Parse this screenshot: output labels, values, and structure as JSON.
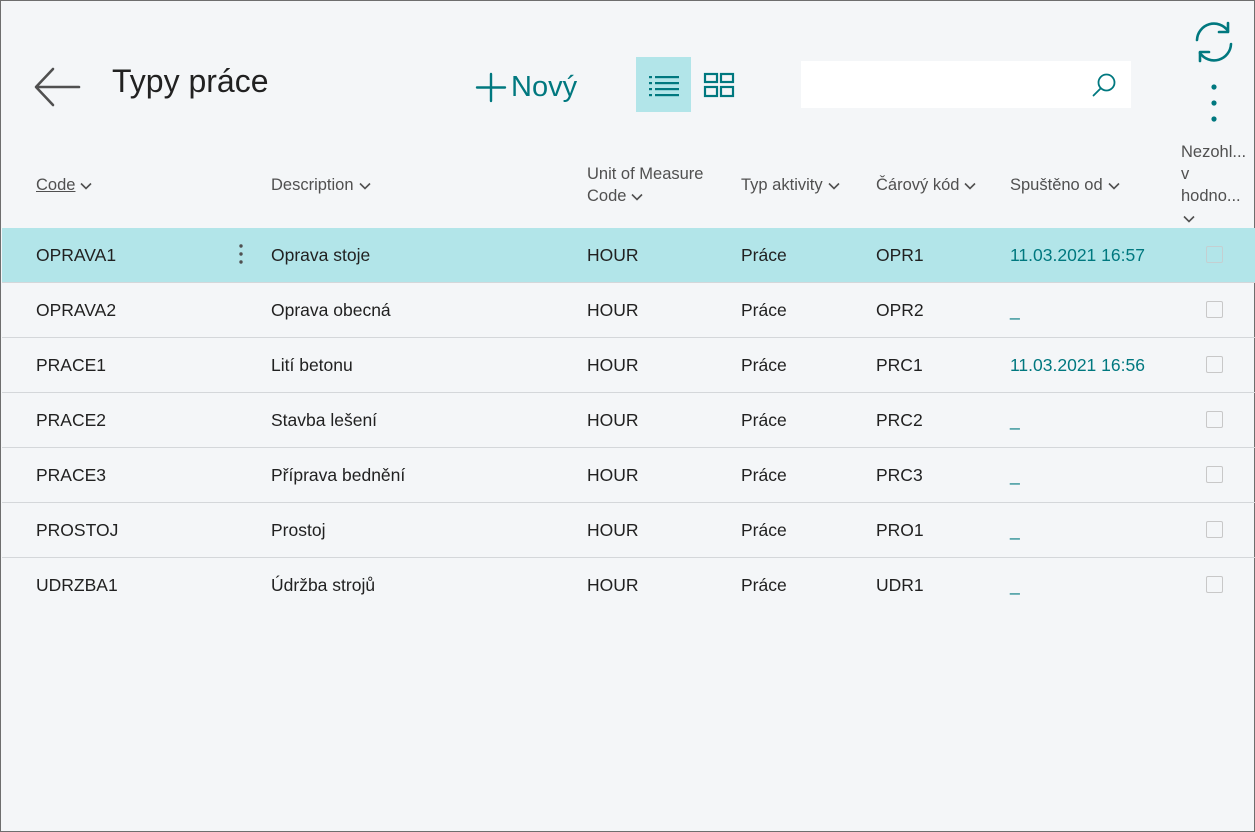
{
  "header": {
    "title": "Typy práce",
    "new_label": "Nový",
    "search": {
      "value": "",
      "placeholder": ""
    }
  },
  "columns": [
    {
      "key": "code",
      "label": "Code"
    },
    {
      "key": "description",
      "label": "Description"
    },
    {
      "key": "uom",
      "label": "Unit of Measure Code",
      "label_line1": "Unit of Measure",
      "label_line2": "Code"
    },
    {
      "key": "activity",
      "label": "Typ aktivity"
    },
    {
      "key": "barcode",
      "label": "Čárový kód"
    },
    {
      "key": "started",
      "label": "Spuštěno od"
    },
    {
      "key": "hidden",
      "label": "Nezohl... v hodno...",
      "label_line1": "Nezohl...",
      "label_line2": "v",
      "label_line3": "hodno..."
    }
  ],
  "rows": [
    {
      "code": "OPRAVA1",
      "description": "Oprava stoje",
      "uom": "HOUR",
      "activity": "Práce",
      "barcode": "OPR1",
      "started": "11.03.2021 16:57",
      "selected": true
    },
    {
      "code": "OPRAVA2",
      "description": "Oprava obecná",
      "uom": "HOUR",
      "activity": "Práce",
      "barcode": "OPR2",
      "started": "_"
    },
    {
      "code": "PRACE1",
      "description": "Lití betonu",
      "uom": "HOUR",
      "activity": "Práce",
      "barcode": "PRC1",
      "started": "11.03.2021 16:56"
    },
    {
      "code": "PRACE2",
      "description": "Stavba lešení",
      "uom": "HOUR",
      "activity": "Práce",
      "barcode": "PRC2",
      "started": "_"
    },
    {
      "code": "PRACE3",
      "description": "Příprava bednění",
      "uom": "HOUR",
      "activity": "Práce",
      "barcode": "PRC3",
      "started": "_"
    },
    {
      "code": "PROSTOJ",
      "description": "Prostoj",
      "uom": "HOUR",
      "activity": "Práce",
      "barcode": "PRO1",
      "started": "_"
    },
    {
      "code": "UDRZBA1",
      "description": "Údržba strojů",
      "uom": "HOUR",
      "activity": "Práce",
      "barcode": "UDR1",
      "started": "_"
    }
  ],
  "icons": {
    "back": "back-arrow-icon",
    "new": "plus-icon",
    "list_view": "list-view-icon",
    "tile_view": "tile-view-icon",
    "search": "search-icon",
    "refresh": "refresh-icon",
    "more": "more-vertical-icon",
    "row_menu": "row-actions-icon",
    "sort": "chevron-down-icon"
  },
  "colors": {
    "accent": "#00787f",
    "selected_row": "#b2e5e9",
    "background": "#f4f6f8"
  }
}
